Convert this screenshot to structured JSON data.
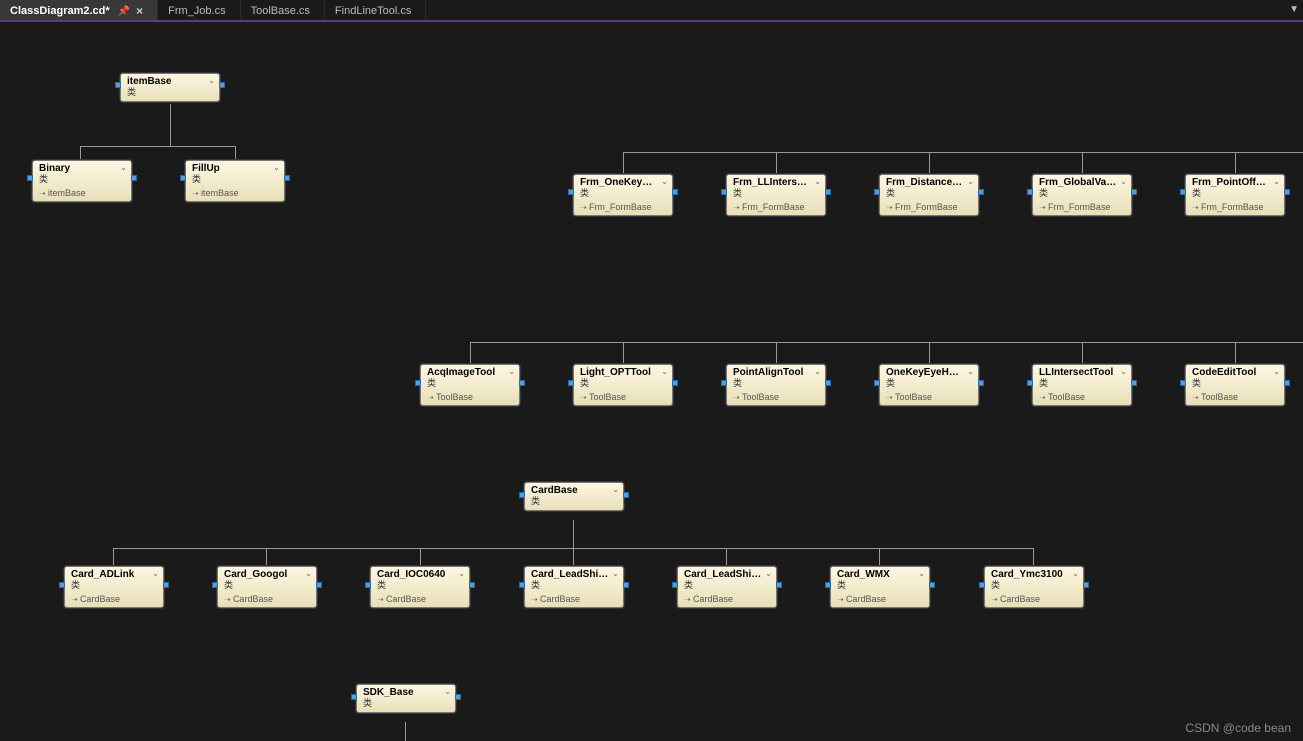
{
  "tabs": {
    "active": "ClassDiagram2.cd*",
    "t1": "Frm_Job.cs",
    "t2": "ToolBase.cs",
    "t3": "FindLineTool.cs"
  },
  "watermark": "CSDN @code bean",
  "stereotype": "类",
  "boxes": {
    "itemBase": {
      "title": "itemBase",
      "inherit": null
    },
    "Binary": {
      "title": "Binary",
      "inherit": "itemBase"
    },
    "FillUp": {
      "title": "FillUp",
      "inherit": "itemBase"
    },
    "frm1": {
      "title": "Frm_OneKeyEy...",
      "inherit": "Frm_FormBase"
    },
    "frm2": {
      "title": "Frm_LLIntersec...",
      "inherit": "Frm_FormBase"
    },
    "frm3": {
      "title": "Frm_DistanceP...",
      "inherit": "Frm_FormBase"
    },
    "frm4": {
      "title": "Frm_GlobalVar...",
      "inherit": "Frm_FormBase"
    },
    "frm5": {
      "title": "Frm_PointOffs...",
      "inherit": "Frm_FormBase"
    },
    "tool1": {
      "title": "AcqImageTool",
      "inherit": "ToolBase"
    },
    "tool2": {
      "title": "Light_OPTTool",
      "inherit": "ToolBase"
    },
    "tool3": {
      "title": "PointAlignTool",
      "inherit": "ToolBase"
    },
    "tool4": {
      "title": "OneKeyEyeHan...",
      "inherit": "ToolBase"
    },
    "tool5": {
      "title": "LLIntersectTool",
      "inherit": "ToolBase"
    },
    "tool6": {
      "title": "CodeEditTool",
      "inherit": "ToolBase"
    },
    "cardBase": {
      "title": "CardBase",
      "inherit": null
    },
    "card1": {
      "title": "Card_ADLink",
      "inherit": "CardBase"
    },
    "card2": {
      "title": "Card_Googol",
      "inherit": "CardBase"
    },
    "card3": {
      "title": "Card_IOC0640",
      "inherit": "CardBase"
    },
    "card4": {
      "title": "Card_LeadShin...",
      "inherit": "CardBase"
    },
    "card5": {
      "title": "Card_LeadShin...",
      "inherit": "CardBase"
    },
    "card6": {
      "title": "Card_WMX",
      "inherit": "CardBase"
    },
    "card7": {
      "title": "Card_Ymc3100",
      "inherit": "CardBase"
    },
    "sdkBase": {
      "title": "SDK_Base",
      "inherit": null
    }
  }
}
